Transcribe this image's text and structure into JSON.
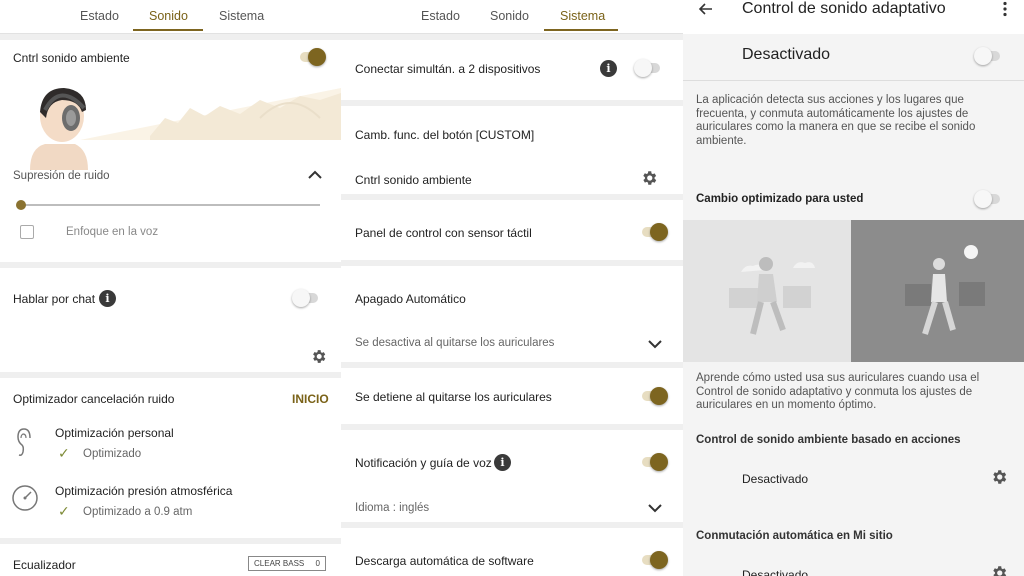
{
  "panel1": {
    "tabs": [
      "Estado",
      "Sonido",
      "Sistema"
    ],
    "active_tab": "Sonido",
    "ambient": {
      "label": "Cntrl sonido ambiente",
      "enabled": true
    },
    "noise": {
      "label": "Supresión de ruido",
      "slider_level": 0,
      "voice_focus_label": "Enfoque en la voz",
      "voice_focus_checked": false
    },
    "chat": {
      "label": "Hablar por chat",
      "info": "i",
      "enabled": false
    },
    "optimizer": {
      "label": "Optimizador cancelación ruido",
      "action": "INICIO",
      "personal": {
        "label": "Optimización personal",
        "status": "Optimizado"
      },
      "pressure": {
        "label": "Optimización presión atmosférica",
        "status": "Optimizado a 0.9 atm"
      }
    },
    "equalizer": {
      "label": "Ecualizador",
      "preset": "CLEAR BASS",
      "preset_value": "0"
    }
  },
  "panel2": {
    "tabs": [
      "Estado",
      "Sonido",
      "Sistema"
    ],
    "active_tab": "Sistema",
    "multipoint": {
      "label": "Conectar simultán. a 2 dispositivos",
      "info": "i",
      "enabled": false
    },
    "custom_button": {
      "label": "Camb. func. del botón [CUSTOM]",
      "value": "Cntrl sonido ambiente"
    },
    "touch_panel": {
      "label": "Panel de control con sensor táctil",
      "enabled": true
    },
    "auto_off": {
      "label": "Apagado Automático",
      "value": "Se desactiva al quitarse los auriculares"
    },
    "pause_when_removed": {
      "label": "Se detiene al quitarse los auriculares",
      "enabled": true
    },
    "voice_guide": {
      "label": "Notificación y guía de voz",
      "info": "i",
      "enabled": true,
      "language": "Idioma : inglés"
    },
    "auto_update": {
      "label": "Descarga automática de software",
      "enabled": true
    }
  },
  "panel3": {
    "title": "Control de sonido adaptativo",
    "status": {
      "label": "Desactivado",
      "enabled": false
    },
    "description": "La aplicación detecta sus acciones y los lugares que frecuenta, y conmuta automáticamente los ajustes de auriculares como la manera en que se recibe el sonido ambiente.",
    "optimized": {
      "label": "Cambio optimizado para usted",
      "enabled": false
    },
    "learn_text": "Aprende cómo usted usa sus auriculares cuando usa el Control de sonido adaptativo y conmuta los ajustes de auriculares en un momento óptimo.",
    "actions_section": {
      "title": "Control de sonido ambiente basado en acciones",
      "value": "Desactivado"
    },
    "place_section": {
      "title": "Conmutación automática en Mi sitio",
      "value": "Desactivado"
    }
  },
  "colors": {
    "accent": "#7d6520",
    "accent_text": "#7a6218",
    "check": "#7d8a36"
  }
}
